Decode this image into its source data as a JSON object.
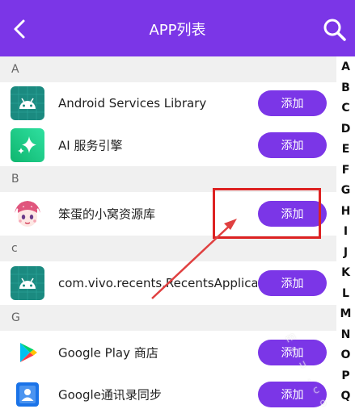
{
  "header": {
    "title": "APP列表"
  },
  "sections": [
    {
      "letter": "A",
      "apps": [
        {
          "name": "Android Services Library",
          "action": "添加"
        },
        {
          "name": "AI 服务引擎",
          "action": "添加"
        }
      ]
    },
    {
      "letter": "B",
      "apps": [
        {
          "name": "笨蛋的小窝资源库",
          "action": "添加"
        }
      ]
    },
    {
      "letter": "c",
      "apps": [
        {
          "name": "com.vivo.recents.RecentsApplication",
          "action": "添加"
        }
      ]
    },
    {
      "letter": "G",
      "apps": [
        {
          "name": "Google Play 商店",
          "action": "添加"
        },
        {
          "name": "Google通讯录同步",
          "action": "添加"
        }
      ]
    }
  ],
  "alphabet": [
    "A",
    "B",
    "C",
    "D",
    "E",
    "F",
    "G",
    "H",
    "I",
    "J",
    "K",
    "L",
    "M",
    "N",
    "O",
    "P",
    "Q"
  ],
  "colors": {
    "accent": "#7b36e7",
    "highlight": "#dd2222"
  }
}
